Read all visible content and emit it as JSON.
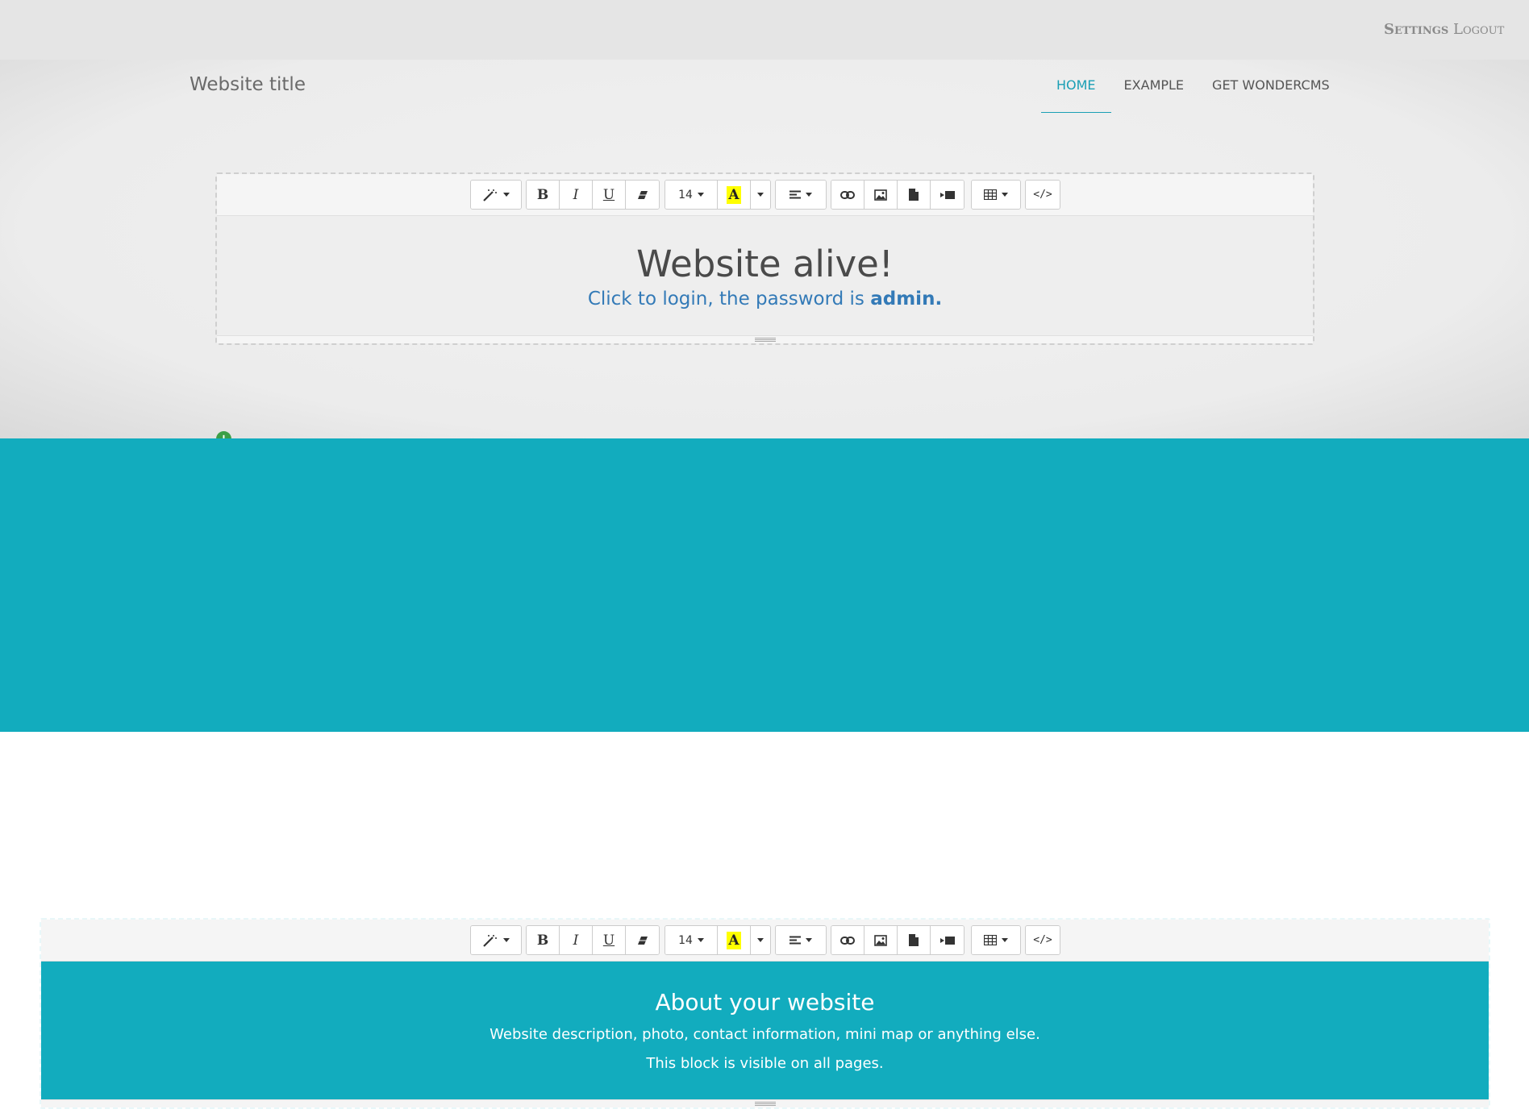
{
  "admin_bar": {
    "settings_label": "Settings",
    "logout_label": "Logout"
  },
  "header": {
    "site_title": "Website title",
    "nav": [
      {
        "label": "HOME",
        "active": true
      },
      {
        "label": "EXAMPLE",
        "active": false
      },
      {
        "label": "GET WONDERCMS",
        "active": false
      }
    ]
  },
  "toolbar": {
    "font_size": "14",
    "highlight_letter": "A",
    "code_view_label": "</>",
    "icons": [
      "magic-wand-icon",
      "bold-icon",
      "italic-icon",
      "underline-icon",
      "eraser-icon",
      "font-size-dropdown",
      "highlight-color-icon",
      "color-dropdown-caret",
      "align-icon",
      "link-icon",
      "image-icon",
      "file-icon",
      "video-icon",
      "table-icon",
      "code-view-icon"
    ],
    "bold_label": "B",
    "italic_label": "I",
    "underline_label": "U",
    "highlight_color": "#ffff00"
  },
  "hero": {
    "heading": "Website alive!",
    "subtitle_prefix": "Click to login, the password is ",
    "subtitle_strong": "admin."
  },
  "footer": {
    "heading": "About your website",
    "line1": "Website description, photo, contact information, mini map or anything else.",
    "line2": "This block is visible on all pages."
  },
  "colors": {
    "accent": "#1a9fb5",
    "footer_bg": "#12acbe",
    "link": "#337ab7",
    "add_button": "#3c9f47"
  }
}
